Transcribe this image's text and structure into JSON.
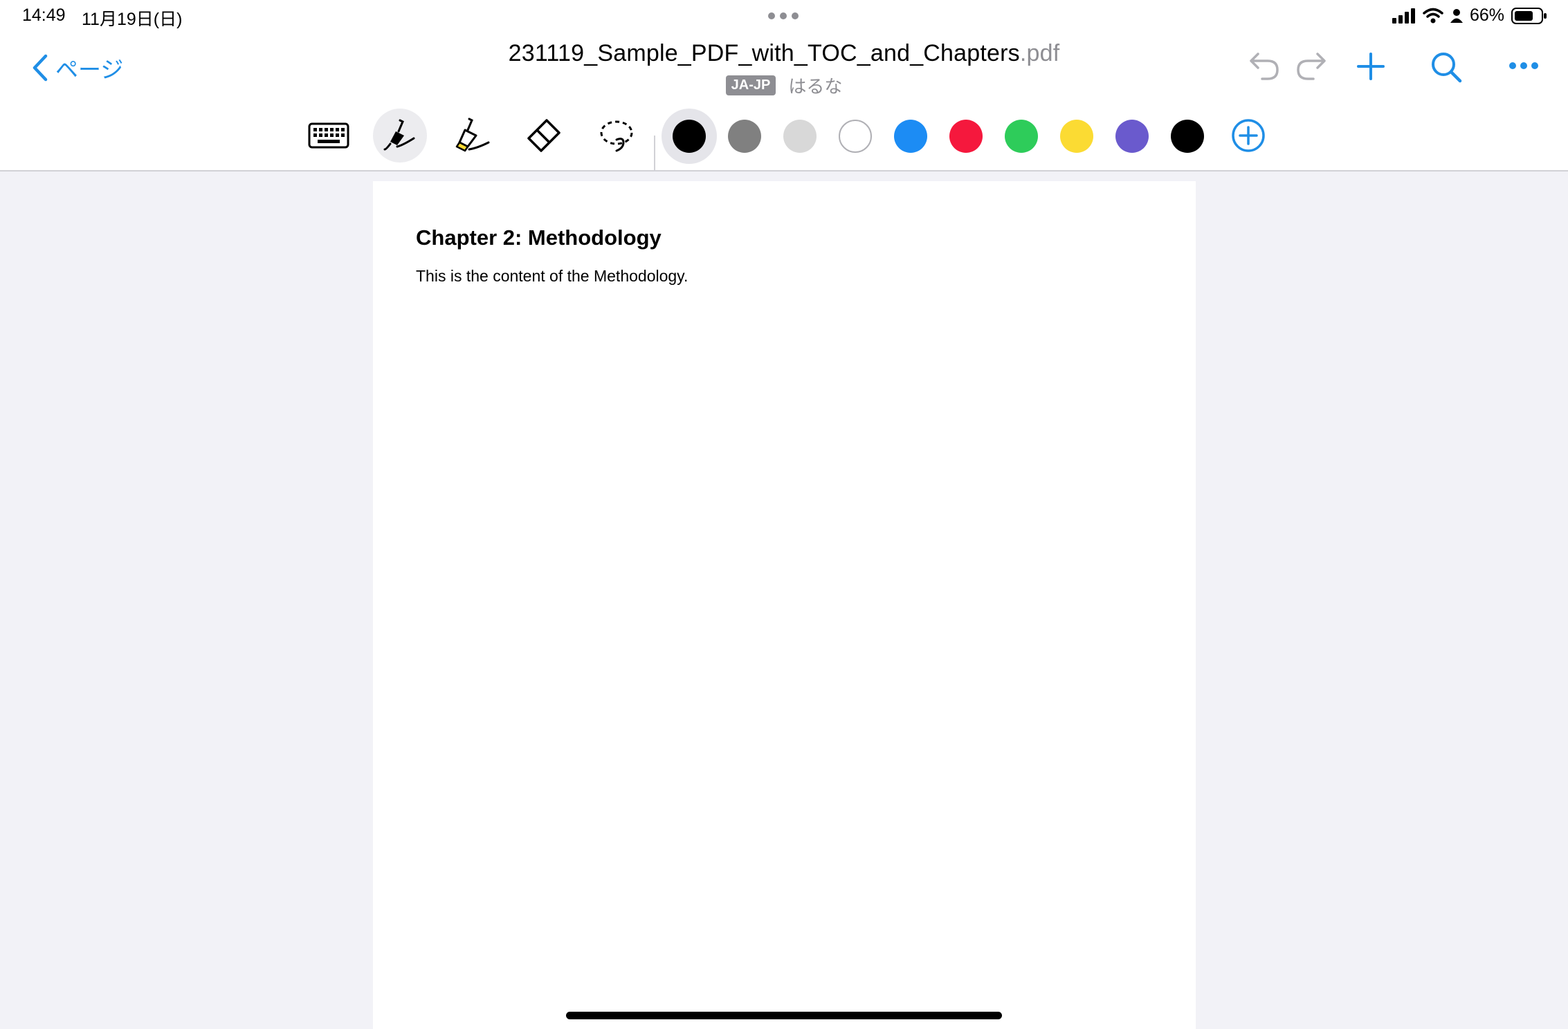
{
  "status_bar": {
    "time": "14:49",
    "date": "11月19日(日)",
    "battery": "66%"
  },
  "nav": {
    "back_label": "ページ",
    "title": "231119_Sample_PDF_with_TOC_and_Chapters",
    "title_ext": ".pdf",
    "language_badge": "JA-JP",
    "author": "はるな",
    "accent_color": "#1f8ee6"
  },
  "toolbar": {
    "tools": [
      "keyboard-icon",
      "pen-icon",
      "highlighter-icon",
      "eraser-icon",
      "lasso-icon"
    ],
    "active_tool": "pen-icon",
    "colors": [
      "#000000",
      "#808080",
      "#d8d8d8",
      "#ffffff",
      "#1c8cf4",
      "#f5183d",
      "#2ecc5a",
      "#fbdb33",
      "#6a5acd",
      "#000000"
    ],
    "selected_color_index": 0
  },
  "document": {
    "heading": "Chapter 2: Methodology",
    "body": "This is the content of the Methodology."
  }
}
